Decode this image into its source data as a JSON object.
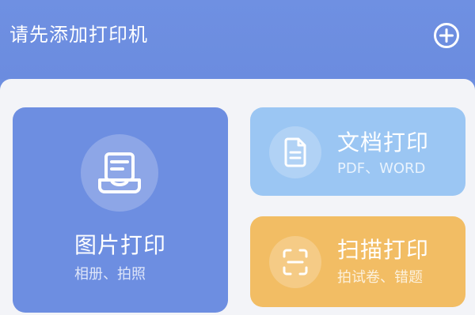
{
  "header": {
    "title": "请先添加打印机",
    "add_icon": "plus-circle-icon"
  },
  "cards": {
    "photo": {
      "title": "图片打印",
      "subtitle": "相册、拍照",
      "icon": "photo-tray-icon",
      "color": "#6d8ee1"
    },
    "document": {
      "title": "文档打印",
      "subtitle": "PDF、WORD",
      "icon": "document-icon",
      "color": "#9bc6f3"
    },
    "scan": {
      "title": "扫描打印",
      "subtitle": "拍试卷、错题",
      "icon": "scan-frame-icon",
      "color": "#f2bd64"
    }
  },
  "colors": {
    "header_bg": "#6d8ee0",
    "content_bg": "#f3f4f8"
  }
}
